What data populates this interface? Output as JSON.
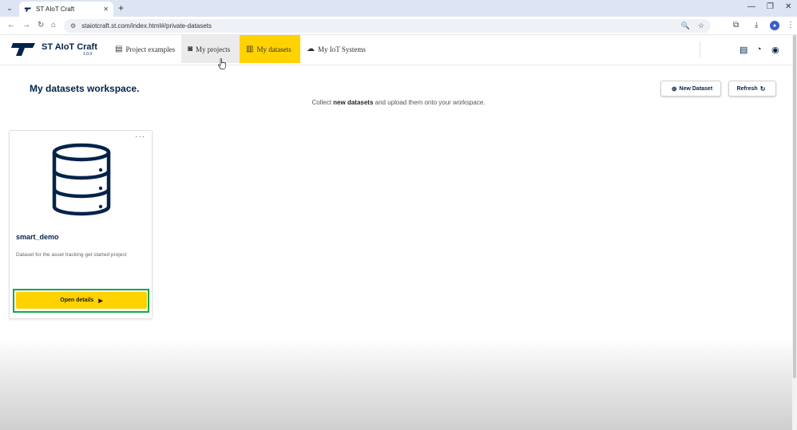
{
  "browser": {
    "tab_title": "ST AIoT Craft",
    "url": "staiotcraft.st.com/index.html#/private-datasets",
    "glyphs": {
      "tab_menu": "⌄",
      "tab_close": "✕",
      "new_tab": "+",
      "minimize": "—",
      "restore": "❐",
      "close": "✕",
      "back": "←",
      "forward": "→",
      "reload": "↻",
      "home": "⌂",
      "site_info": "⚙",
      "zoom": "🔍",
      "bookmark": "☆",
      "extensions": "⧉",
      "download": "⤓",
      "menu": "⋮",
      "profile": "●"
    }
  },
  "app": {
    "brand": "ST AIoT Craft",
    "version": "1.0.0",
    "nav": [
      {
        "label": "Project examples",
        "icon": "▤",
        "icon_name": "examples-icon"
      },
      {
        "label": "My projects",
        "icon": "◙",
        "icon_name": "projects-icon"
      },
      {
        "label": "My datasets",
        "icon": "▥",
        "icon_name": "datasets-icon"
      },
      {
        "label": "My IoT Systems",
        "icon": "☁",
        "icon_name": "cloud-icon"
      }
    ],
    "header_icons": {
      "docs": "▤",
      "dashboard": "◔",
      "account": "◉"
    }
  },
  "workspace": {
    "title": "My datasets workspace.",
    "subtitle_pre": "Collect",
    "subtitle_bold": "new datasets",
    "subtitle_post": "and upload them onto your workspace.",
    "new_dataset_label": "New Dataset",
    "new_dataset_icon": "⊕",
    "refresh_label": "Refresh",
    "refresh_icon": "↻"
  },
  "dataset_card": {
    "menu": "···",
    "name": "smart_demo",
    "description": "Dataset for the asset tracking get started project",
    "button_label": "Open details",
    "button_icon": "▶"
  },
  "colors": {
    "brand_navy": "#03234b",
    "accent_yellow": "#ffd200",
    "highlight_green": "#14a84a"
  }
}
